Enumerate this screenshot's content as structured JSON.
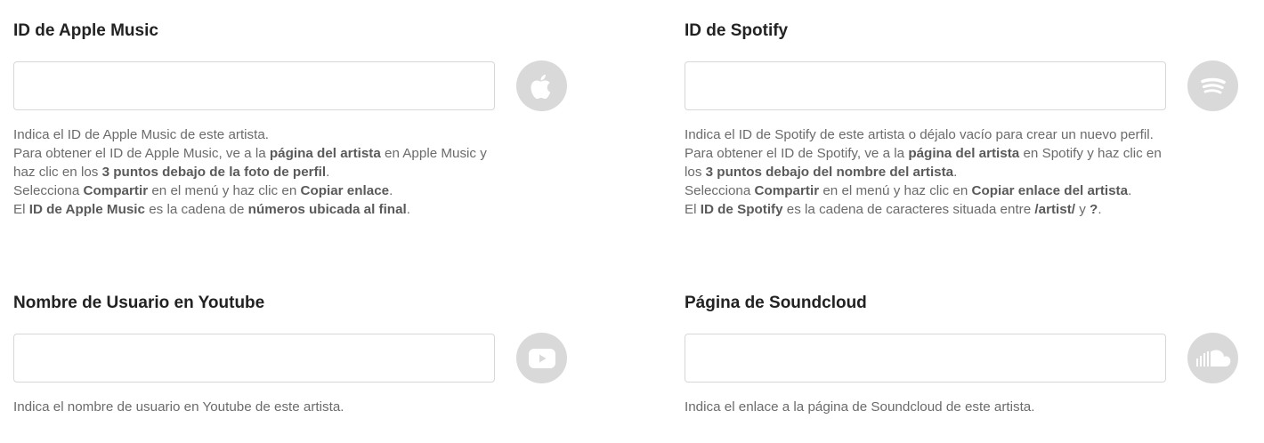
{
  "apple": {
    "label": "ID de Apple Music",
    "value": "",
    "icon": "apple-icon",
    "help": [
      [
        {
          "t": "Indica el ID de Apple Music de este artista."
        }
      ],
      [
        {
          "t": "Para obtener el ID de Apple Music, ve a la "
        },
        {
          "t": "página del artista",
          "b": true
        },
        {
          "t": " en Apple Music y haz clic en los "
        },
        {
          "t": "3 puntos debajo de la foto de perfil",
          "b": true
        },
        {
          "t": "."
        }
      ],
      [
        {
          "t": "Selecciona "
        },
        {
          "t": "Compartir",
          "b": true
        },
        {
          "t": " en el menú y haz clic en "
        },
        {
          "t": "Copiar enlace",
          "b": true
        },
        {
          "t": "."
        }
      ],
      [
        {
          "t": "El "
        },
        {
          "t": "ID de Apple Music",
          "b": true
        },
        {
          "t": " es la cadena de "
        },
        {
          "t": "números ubicada al final",
          "b": true
        },
        {
          "t": "."
        }
      ]
    ]
  },
  "spotify": {
    "label": "ID de Spotify",
    "value": "",
    "icon": "spotify-icon",
    "help": [
      [
        {
          "t": "Indica el ID de Spotify de este artista o déjalo vacío para crear un nuevo perfil."
        }
      ],
      [
        {
          "t": "Para obtener el ID de Spotify, ve a la "
        },
        {
          "t": "página del artista",
          "b": true
        },
        {
          "t": " en Spotify y haz clic en los "
        },
        {
          "t": "3 puntos debajo del nombre del artista",
          "b": true
        },
        {
          "t": "."
        }
      ],
      [
        {
          "t": "Selecciona "
        },
        {
          "t": "Compartir",
          "b": true
        },
        {
          "t": " en el menú y haz clic en "
        },
        {
          "t": "Copiar enlace del artista",
          "b": true
        },
        {
          "t": "."
        }
      ],
      [
        {
          "t": "El "
        },
        {
          "t": "ID de Spotify",
          "b": true
        },
        {
          "t": " es la cadena de caracteres situada entre "
        },
        {
          "t": "/artist/",
          "b": true
        },
        {
          "t": " y "
        },
        {
          "t": "?",
          "b": true
        },
        {
          "t": "."
        }
      ]
    ]
  },
  "youtube": {
    "label": "Nombre de Usuario en Youtube",
    "value": "",
    "icon": "youtube-icon",
    "help": [
      [
        {
          "t": "Indica el nombre de usuario en Youtube de este artista."
        }
      ]
    ]
  },
  "soundcloud": {
    "label": "Página de Soundcloud",
    "value": "",
    "icon": "soundcloud-icon",
    "help": [
      [
        {
          "t": "Indica el enlace a la página de Soundcloud de este artista."
        }
      ]
    ]
  },
  "colors": {
    "icon_bg": "#d9d9d9",
    "icon_fg": "#ffffff",
    "help_text": "#6b6b6b",
    "border": "#d7d7d7"
  }
}
